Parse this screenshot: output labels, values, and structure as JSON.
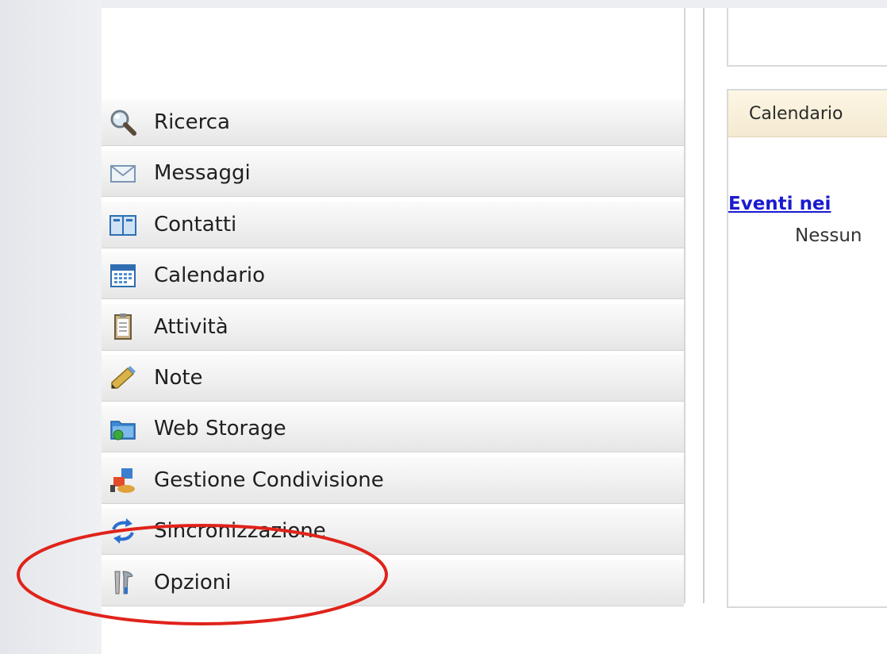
{
  "sidebar": {
    "items": [
      {
        "label": "Ricerca",
        "icon": "search-icon"
      },
      {
        "label": "Messaggi",
        "icon": "envelope-icon"
      },
      {
        "label": "Contatti",
        "icon": "address-book-icon"
      },
      {
        "label": "Calendario",
        "icon": "calendar-icon"
      },
      {
        "label": "Attività",
        "icon": "task-list-icon"
      },
      {
        "label": "Note",
        "icon": "pencil-note-icon"
      },
      {
        "label": "Web Storage",
        "icon": "folder-storage-icon"
      },
      {
        "label": "Gestione Condivisione",
        "icon": "sharing-icon"
      },
      {
        "label": "Sincronizzazione",
        "icon": "sync-arrows-icon"
      },
      {
        "label": "Opzioni",
        "icon": "tools-icon"
      }
    ]
  },
  "calendar_portlet": {
    "title": "Calendario",
    "events_link": "Eventi nei",
    "empty_text": "Nessun"
  },
  "colors": {
    "highlight": "#e0231b",
    "link": "#1a1ad0",
    "portlet_header": "#f7efda"
  }
}
